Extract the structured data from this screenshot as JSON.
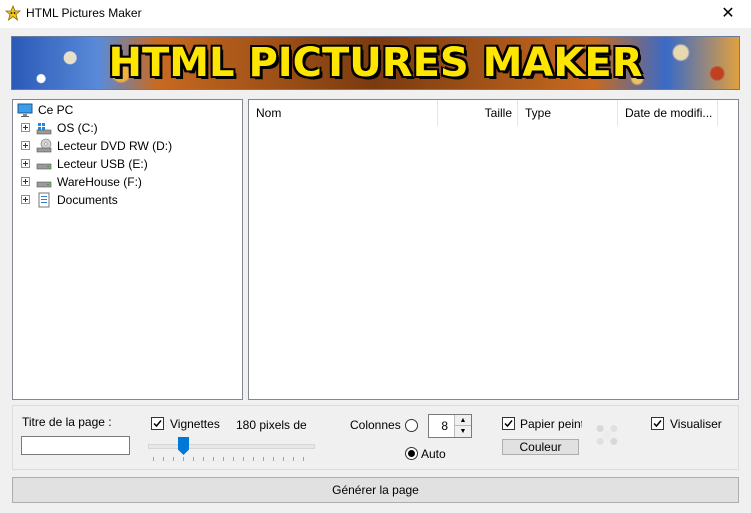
{
  "window": {
    "title": "HTML Pictures Maker",
    "close_glyph": "✕"
  },
  "banner": {
    "text": "HTML PICTURES MAKER"
  },
  "tree": {
    "root": "Ce PC",
    "items": [
      {
        "label": "OS (C:)",
        "icon": "windows-drive-icon"
      },
      {
        "label": "Lecteur DVD RW (D:)",
        "icon": "dvd-drive-icon"
      },
      {
        "label": "Lecteur USB (E:)",
        "icon": "usb-drive-icon"
      },
      {
        "label": "WareHouse (F:)",
        "icon": "drive-icon"
      },
      {
        "label": "Documents",
        "icon": "documents-icon"
      }
    ]
  },
  "list": {
    "columns": [
      "Nom",
      "Taille",
      "Type",
      "Date de modifi..."
    ]
  },
  "options": {
    "page_title_label": "Titre de la page :",
    "page_title_value": "",
    "vignettes_label": "Vignettes",
    "vignettes_checked": true,
    "pixels_label": "180 pixels de",
    "colonnes_label": "Colonnes",
    "colonnes_value": "8",
    "auto_label": "Auto",
    "papier_peint_label": "Papier peint",
    "papier_peint_checked": true,
    "couleur_label": "Couleur",
    "visualiser_label": "Visualiser",
    "visualiser_checked": true
  },
  "generate_button": "Générer la page",
  "colors": {
    "accent": "#0078d7",
    "banner_text": "#ffe600"
  }
}
